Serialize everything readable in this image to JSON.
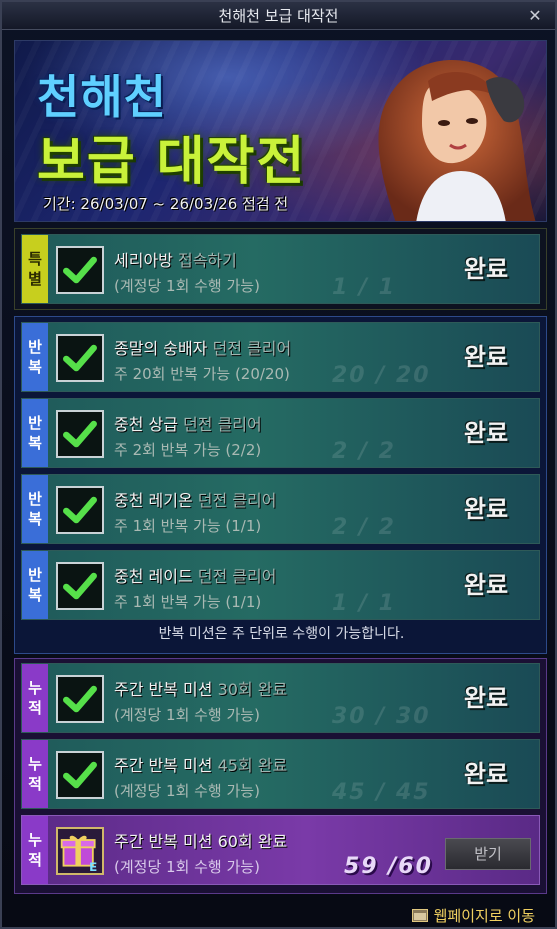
{
  "window": {
    "title": "천해천 보급 대작전",
    "close_symbol": "✕"
  },
  "banner": {
    "title_line1": "천해천",
    "title_line2": "보급 대작전",
    "period": "기간: 26/03/07 ~ 26/03/26 점검 전"
  },
  "special": [
    {
      "tag": [
        "특",
        "별"
      ],
      "name": "세리아방",
      "name_dim": " 접속하기",
      "sub": "(계정당 1회 수행 가능)",
      "ghost": "1 / 1",
      "status": "완료"
    }
  ],
  "repeat": [
    {
      "tag": [
        "반",
        "복"
      ],
      "name": "종말의 숭배자",
      "name_dim": " 던전 클리어",
      "sub": "주 20회 반복 가능 (20/20)",
      "ghost": "20 / 20",
      "status": "완료"
    },
    {
      "tag": [
        "반",
        "복"
      ],
      "name": "중천 상급",
      "name_dim": " 던전 클리어",
      "sub": "주 2회 반복 가능 (2/2)",
      "ghost": "2 / 2",
      "status": "완료"
    },
    {
      "tag": [
        "반",
        "복"
      ],
      "name": "중천 레기온",
      "name_dim": " 던전 클리어",
      "sub": "주 1회 반복 가능 (1/1)",
      "ghost": "2 / 2",
      "status": "완료"
    },
    {
      "tag": [
        "반",
        "복"
      ],
      "name": "중천 레이드",
      "name_dim": " 던전 클리어",
      "sub": "주 1회 반복 가능 (1/1)",
      "ghost": "1 / 1",
      "status": "완료"
    }
  ],
  "repeat_notice": "반복 미션은 주 단위로 수행이 가능합니다.",
  "accum": [
    {
      "tag": [
        "누",
        "적"
      ],
      "name": "주간 반복 미션",
      "name_dim": " 30회 완료",
      "sub": "(계정당 1회 수행 가능)",
      "ghost": "30 / 30",
      "status": "완료"
    },
    {
      "tag": [
        "누",
        "적"
      ],
      "name": "주간 반복 미션",
      "name_dim": " 45회 완료",
      "sub": "(계정당 1회 수행 가능)",
      "ghost": "45 / 45",
      "status": "완료"
    },
    {
      "tag": [
        "누",
        "적"
      ],
      "name": "주간 반복 미션",
      "name_dim": " 60회 완료",
      "sub": "(계정당 1회 수행 가능)",
      "progress": "59 /60",
      "button": "받기"
    }
  ],
  "footer": {
    "link": "웹페이지로 이동"
  },
  "colors": {
    "special": "#c7cf1e",
    "repeat": "#3a6ed8",
    "accum": "#8a3ac8",
    "done_row": "#256b63",
    "pending_row": "#7a3aa8"
  }
}
